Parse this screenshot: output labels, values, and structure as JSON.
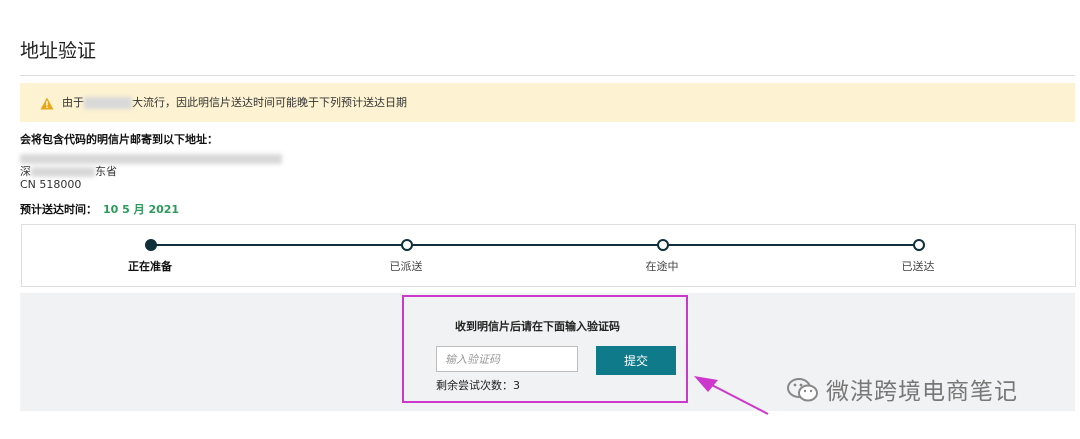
{
  "page": {
    "title": "地址验证"
  },
  "alert": {
    "prefix": "由于",
    "suffix": "大流行，因此明信片送达时间可能晚于下列预计送达日期"
  },
  "address": {
    "label": "会将包含代码的明信片邮寄到以下地址：",
    "line2_visible_a": "深",
    "line2_visible_b": "东省",
    "line3": "CN 518000"
  },
  "eta": {
    "label": "预计送达时间：",
    "value": "10 5 月 2021"
  },
  "steps": [
    {
      "label": "正在准备",
      "active": true
    },
    {
      "label": "已派送",
      "active": false
    },
    {
      "label": "在途中",
      "active": false
    },
    {
      "label": "已送达",
      "active": false
    }
  ],
  "verify": {
    "prompt": "收到明信片后请在下面输入验证码",
    "placeholder": "输入验证码",
    "submit_label": "提交",
    "attempts_text": "剩余尝试次数：3"
  },
  "watermark": {
    "text": "微淇跨境电商笔记"
  },
  "colors": {
    "accent": "#0e7a8a",
    "eta_green": "#2a9a5a",
    "alert_bg": "#fdf3d2",
    "highlight": "#cc37cc"
  }
}
